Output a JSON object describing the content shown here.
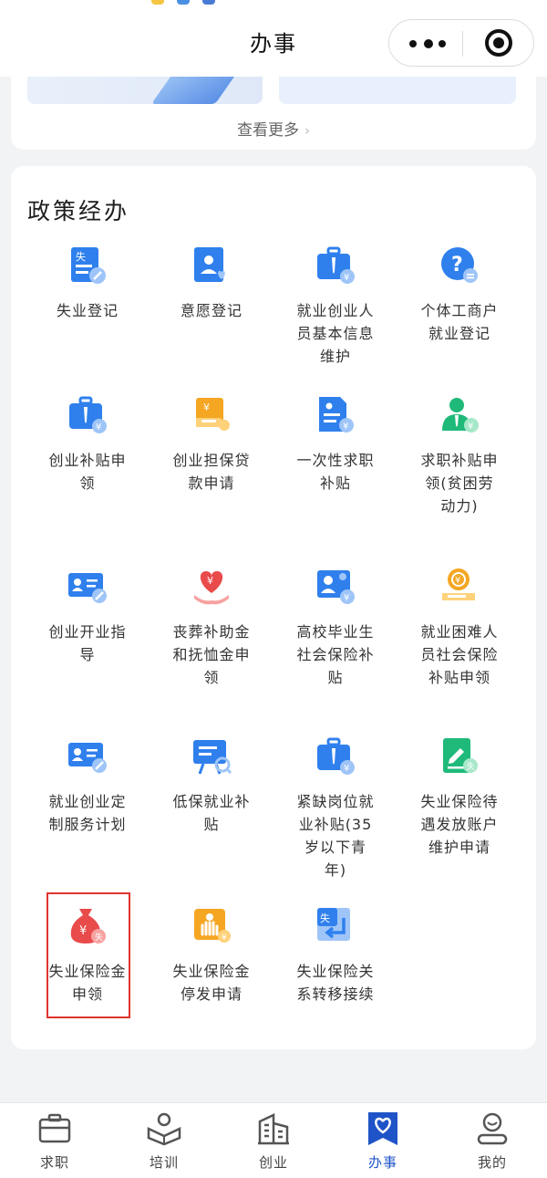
{
  "nav": {
    "title": "办事"
  },
  "prev_card": {
    "see_more": "查看更多",
    "see_more_chevron": "›"
  },
  "policy": {
    "title": "政策经办",
    "items": [
      {
        "label": "失业登记",
        "icon": "unemployment-registration-icon"
      },
      {
        "label": "意愿登记",
        "icon": "intention-registration-icon"
      },
      {
        "label": "就业创业人员基本信息维护",
        "icon": "briefcase-info-icon"
      },
      {
        "label": "个体工商户就业登记",
        "icon": "question-icon"
      },
      {
        "label": "创业补贴申领",
        "icon": "briefcase-subsidy-icon"
      },
      {
        "label": "创业担保贷款申请",
        "icon": "loan-icon"
      },
      {
        "label": "一次性求职补贴",
        "icon": "document-yuan-icon"
      },
      {
        "label": "求职补贴申领(贫困劳动力)",
        "icon": "person-subsidy-icon"
      },
      {
        "label": "创业开业指导",
        "icon": "id-card-icon"
      },
      {
        "label": "丧葬补助金和抚恤金申领",
        "icon": "heart-hand-icon"
      },
      {
        "label": "高校毕业生社会保险补贴",
        "icon": "graduate-card-icon"
      },
      {
        "label": "就业困难人员社会保险补贴申领",
        "icon": "coin-stack-icon"
      },
      {
        "label": "就业创业定制服务计划",
        "icon": "id-card-edit-icon"
      },
      {
        "label": "低保就业补贴",
        "icon": "presentation-icon"
      },
      {
        "label": "紧缺岗位就业补贴(35岁以下青年)",
        "icon": "briefcase-yuan-icon"
      },
      {
        "label": "失业保险待遇发放账户维护申请",
        "icon": "edit-document-icon"
      },
      {
        "label": "失业保险金申领",
        "icon": "money-bag-icon"
      },
      {
        "label": "失业保险金停发申请",
        "icon": "hand-stop-icon"
      },
      {
        "label": "失业保险关系转移接续",
        "icon": "transfer-icon"
      }
    ]
  },
  "tabs": [
    {
      "label": "求职",
      "icon": "briefcase-icon",
      "active": false
    },
    {
      "label": "培训",
      "icon": "training-icon",
      "active": false
    },
    {
      "label": "创业",
      "icon": "building-icon",
      "active": false
    },
    {
      "label": "办事",
      "icon": "heart-badge-icon",
      "active": true
    },
    {
      "label": "我的",
      "icon": "user-icon",
      "active": false
    }
  ],
  "colors": {
    "accent": "#1f54c8",
    "icon_blue": "#2f80ed",
    "icon_orange": "#f5a623",
    "icon_red": "#e94a4a",
    "icon_green": "#1fb97a",
    "highlight": "#e0342f"
  }
}
